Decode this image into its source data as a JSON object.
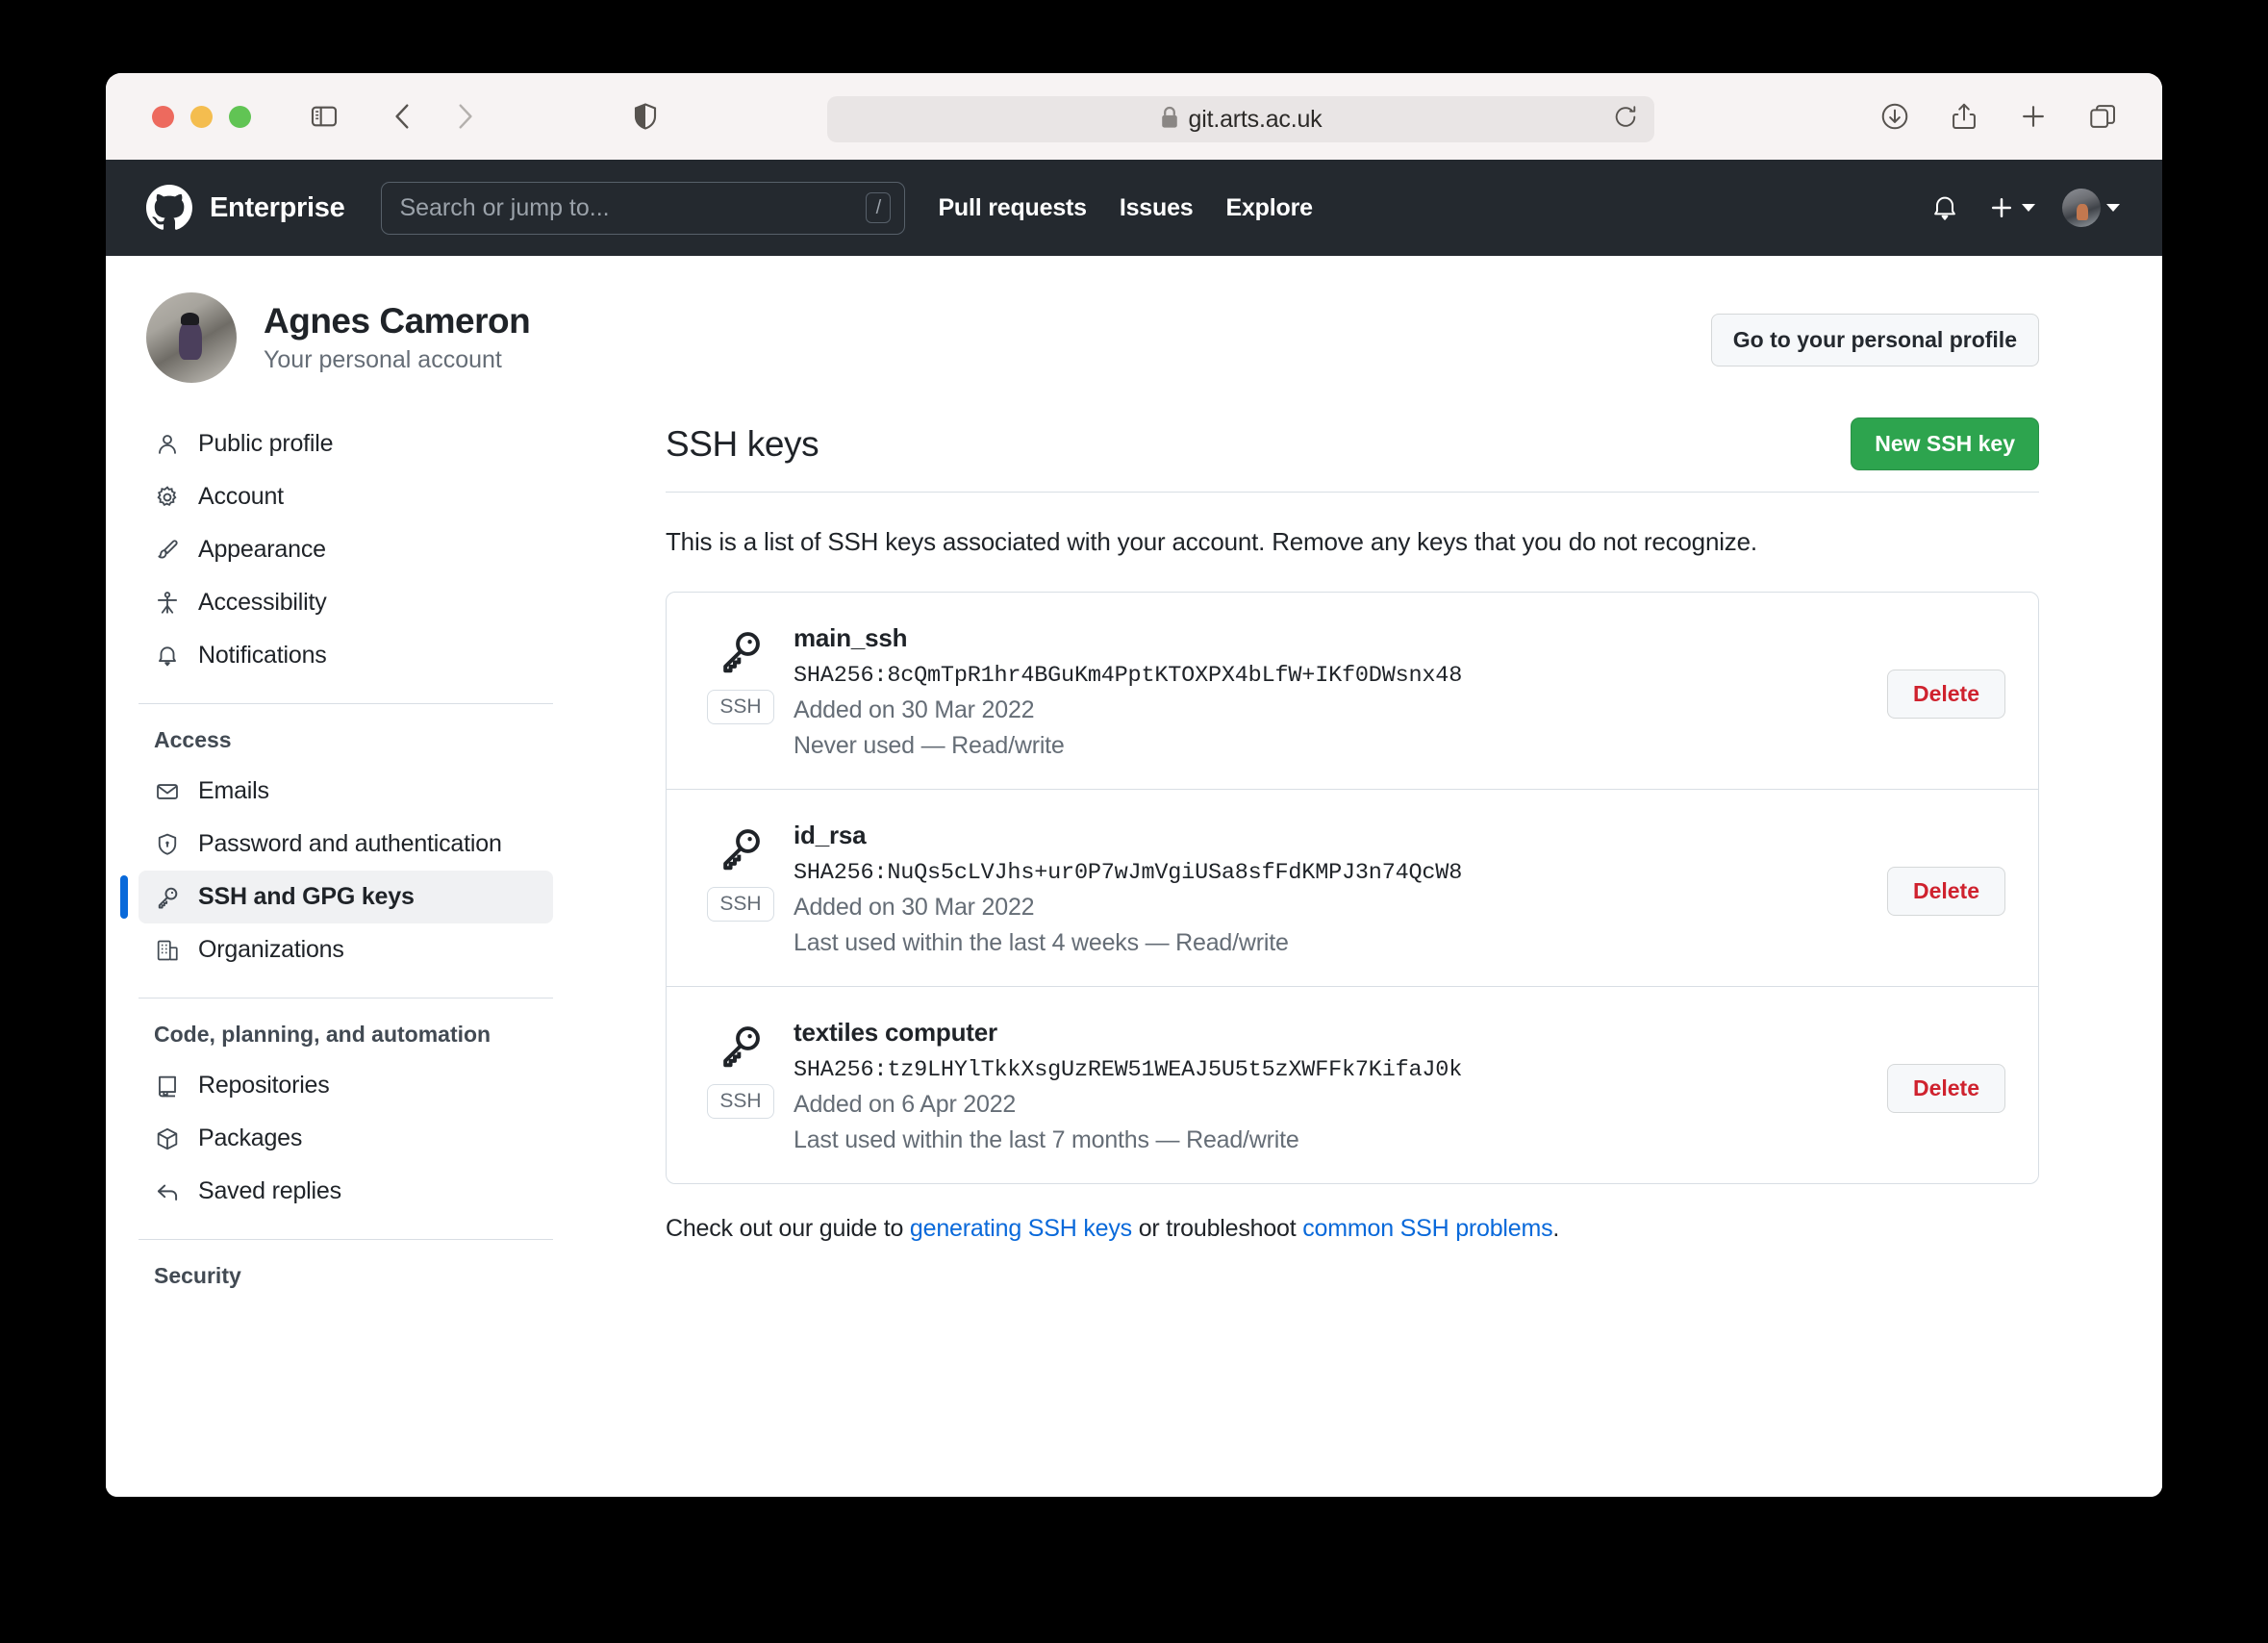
{
  "browser": {
    "url": "git.arts.ac.uk",
    "lock_icon": "lock-icon",
    "traffic_lights": [
      "close",
      "minimize",
      "zoom"
    ],
    "icons": {
      "sidebar_toggle": "sidebar-toggle-icon",
      "back": "chevron-left-icon",
      "forward": "chevron-right-icon",
      "shield": "shield-icon",
      "reload": "reload-icon",
      "downloads": "download-icon",
      "share": "share-icon",
      "new_tab": "plus-icon",
      "tab_overview": "tab-overview-icon"
    }
  },
  "gh_header": {
    "logo_icon": "github-mark-icon",
    "product_label": "Enterprise",
    "search_placeholder": "Search or jump to...",
    "search_shortcut": "/",
    "nav": [
      {
        "label": "Pull requests",
        "name": "nav-pull-requests"
      },
      {
        "label": "Issues",
        "name": "nav-issues"
      },
      {
        "label": "Explore",
        "name": "nav-explore"
      }
    ],
    "right_icons": {
      "notifications": "bell-icon",
      "create_new": "plus-icon",
      "account": "avatar-icon"
    }
  },
  "profile": {
    "name": "Agnes Cameron",
    "subtitle": "Your personal account",
    "go_to_profile_label": "Go to your personal profile",
    "avatar_name": "user-avatar"
  },
  "sidebar": {
    "groups": [
      {
        "title": null,
        "items": [
          {
            "label": "Public profile",
            "icon": "person-icon",
            "active": false,
            "name": "sidebar-item-public-profile"
          },
          {
            "label": "Account",
            "icon": "gear-icon",
            "active": false,
            "name": "sidebar-item-account"
          },
          {
            "label": "Appearance",
            "icon": "paintbrush-icon",
            "active": false,
            "name": "sidebar-item-appearance"
          },
          {
            "label": "Accessibility",
            "icon": "accessibility-icon",
            "active": false,
            "name": "sidebar-item-accessibility"
          },
          {
            "label": "Notifications",
            "icon": "bell-icon",
            "active": false,
            "name": "sidebar-item-notifications"
          }
        ]
      },
      {
        "title": "Access",
        "items": [
          {
            "label": "Emails",
            "icon": "mail-icon",
            "active": false,
            "name": "sidebar-item-emails"
          },
          {
            "label": "Password and authentication",
            "icon": "shield-lock-icon",
            "active": false,
            "name": "sidebar-item-password-and-authentication"
          },
          {
            "label": "SSH and GPG keys",
            "icon": "key-icon",
            "active": true,
            "name": "sidebar-item-ssh-and-gpg-keys"
          },
          {
            "label": "Organizations",
            "icon": "organization-icon",
            "active": false,
            "name": "sidebar-item-organizations"
          }
        ]
      },
      {
        "title": "Code, planning, and automation",
        "items": [
          {
            "label": "Repositories",
            "icon": "repo-icon",
            "active": false,
            "name": "sidebar-item-repositories"
          },
          {
            "label": "Packages",
            "icon": "package-icon",
            "active": false,
            "name": "sidebar-item-packages"
          },
          {
            "label": "Saved replies",
            "icon": "reply-icon",
            "active": false,
            "name": "sidebar-item-saved-replies"
          }
        ]
      },
      {
        "title": "Security",
        "items": []
      }
    ]
  },
  "main": {
    "title": "SSH keys",
    "new_key_button": "New SSH key",
    "description": "This is a list of SSH keys associated with your account. Remove any keys that you do not recognize.",
    "delete_label": "Delete",
    "badge_label": "SSH",
    "keys": [
      {
        "title": "main_ssh",
        "fingerprint": "SHA256:8cQmTpR1hr4BGuKm4PptKTOXPX4bLfW+IKf0DWsnx48",
        "added": "Added on 30 Mar 2022",
        "last_used": "Never used — Read/write"
      },
      {
        "title": "id_rsa",
        "fingerprint": "SHA256:NuQs5cLVJhs+ur0P7wJmVgiUSa8sfFdKMPJ3n74QcW8",
        "added": "Added on 30 Mar 2022",
        "last_used": "Last used within the last 4 weeks — Read/write"
      },
      {
        "title": "textiles computer",
        "fingerprint": "SHA256:tz9LHYlTkkXsgUzREW51WEAJ5U5t5zXWFFk7KifaJ0k",
        "added": "Added on 6 Apr 2022",
        "last_used": "Last used within the last 7 months — Read/write"
      }
    ],
    "footer": {
      "prefix": "Check out our guide to ",
      "link1": "generating SSH keys",
      "middle": " or troubleshoot ",
      "link2": "common SSH problems",
      "suffix": "."
    }
  },
  "colors": {
    "accent_green": "#2da44e",
    "link_blue": "#0969da",
    "danger_red": "#cf222e",
    "header_dark": "#24292f"
  }
}
